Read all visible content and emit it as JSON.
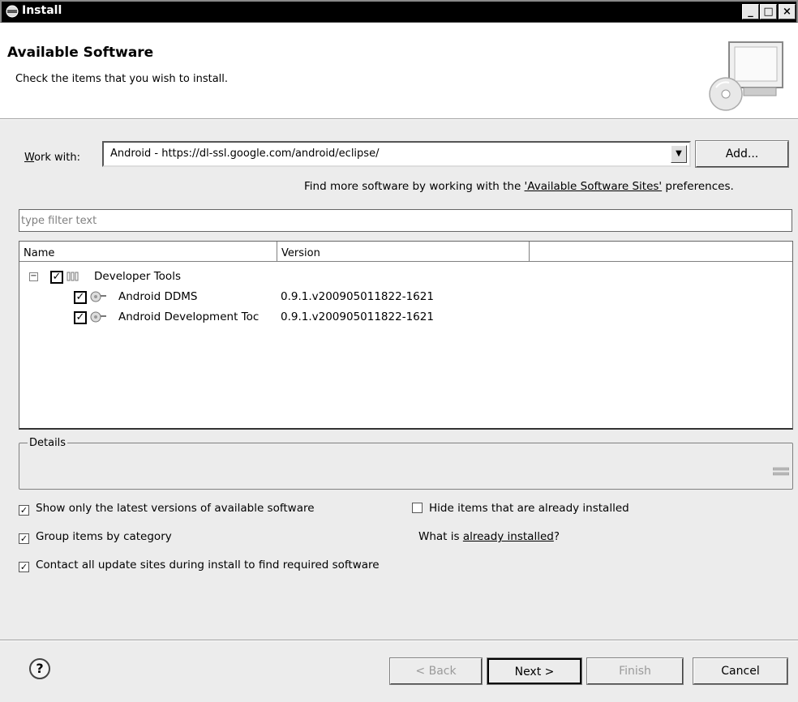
{
  "window": {
    "title": "Install",
    "controls": {
      "minimize": "_",
      "maximize": "□",
      "close": "×"
    }
  },
  "banner": {
    "title": "Available Software",
    "subtitle": "Check the items that you wish to install.",
    "icon": "computer-cd-icon"
  },
  "work_with": {
    "label": "Work with:",
    "value": "Android - https://dl-ssl.google.com/android/eclipse/",
    "add_button": "Add..."
  },
  "find_more": {
    "prefix": "Find more software by working with the ",
    "link": "'Available Software Sites'",
    "suffix": " preferences."
  },
  "filter": {
    "placeholder": "type filter text"
  },
  "tree": {
    "columns": [
      "Name",
      "Version",
      ""
    ],
    "category": {
      "label": "Developer Tools",
      "checked": true,
      "expanded": true
    },
    "items": [
      {
        "name": "Android DDMS",
        "version": "0.9.1.v200905011822-1621",
        "checked": true
      },
      {
        "name": "Android Development Toc",
        "version": "0.9.1.v200905011822-1621",
        "checked": true
      }
    ]
  },
  "details": {
    "legend": "Details"
  },
  "options": {
    "latest_versions": {
      "label": "Show only the latest versions of available software",
      "checked": true
    },
    "hide_installed": {
      "label": "Hide items that are already installed",
      "checked": false
    },
    "group_by_category": {
      "label": "Group items by category",
      "checked": true
    },
    "already_installed": {
      "prefix": "What is ",
      "link": "already installed",
      "suffix": "?"
    },
    "contact_sites": {
      "label": "Contact all update sites during install to find required software",
      "checked": true
    }
  },
  "footer": {
    "back": "< Back",
    "next": "Next >",
    "finish": "Finish",
    "cancel": "Cancel",
    "help": "?"
  }
}
